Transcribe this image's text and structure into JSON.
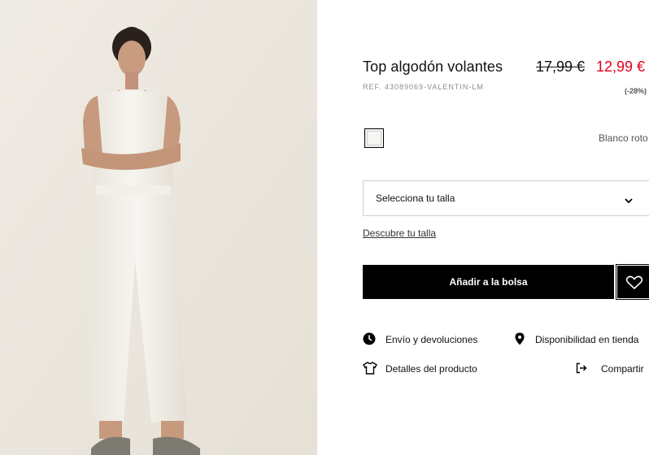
{
  "photo": {
    "alt_icon": "model-photo",
    "bg": "#ece8e0"
  },
  "product": {
    "title": "Top algodón volantes",
    "old_price": "17,99 €",
    "new_price": "12,99 €",
    "ref": "REF. 43089069-VALENTIN-LM",
    "discount": "(-28%)",
    "price_color": "#e2001a"
  },
  "color": {
    "name": "Blanco roto",
    "swatch_color": "#f6f6f4"
  },
  "size": {
    "placeholder": "Selecciona tu talla",
    "icon": "chevron-down-icon"
  },
  "discover_label": "Descubre tu talla",
  "actions": {
    "add_label": "Añadir a la bolsa",
    "favorite_icon": "heart-icon"
  },
  "links": {
    "shipping": "Envío y devoluciones",
    "availability": "Disponibilidad en tienda",
    "details": "Detalles del producto",
    "share": "Compartir"
  }
}
